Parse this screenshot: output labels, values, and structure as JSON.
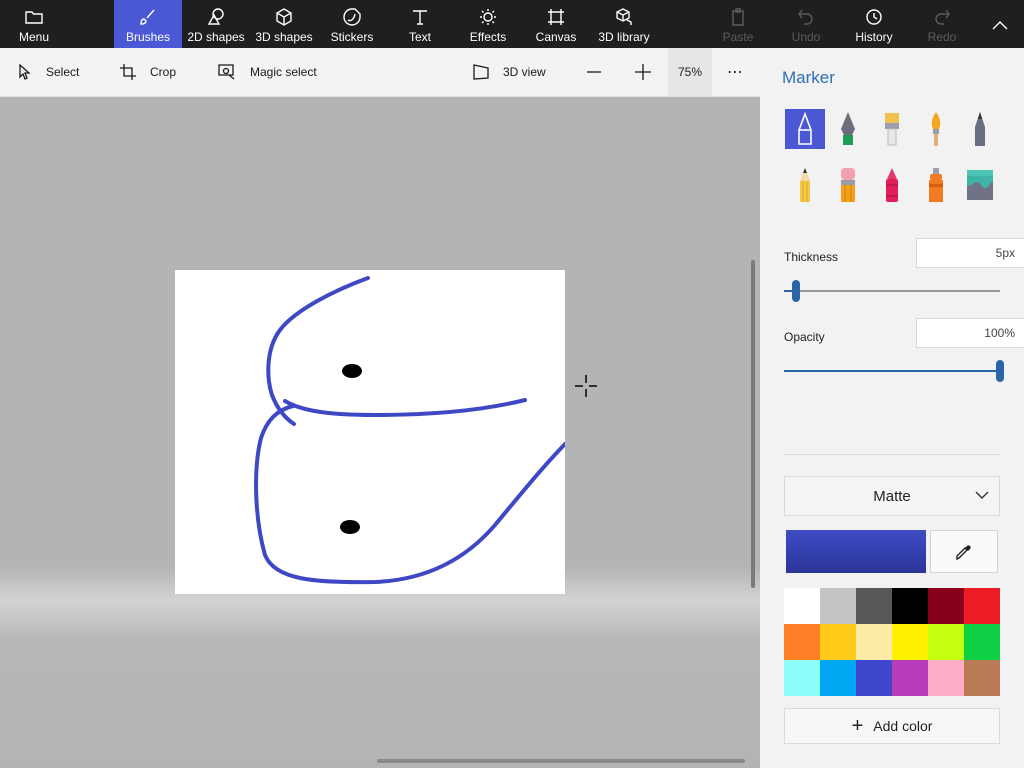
{
  "ribbon": {
    "menu": "Menu",
    "tabs": [
      "Brushes",
      "2D shapes",
      "3D shapes",
      "Stickers",
      "Text",
      "Effects",
      "Canvas",
      "3D library"
    ],
    "actions": {
      "paste": "Paste",
      "undo": "Undo",
      "history": "History",
      "redo": "Redo"
    }
  },
  "toolbar": {
    "select": "Select",
    "crop": "Crop",
    "magic_select": "Magic select",
    "view3d": "3D view",
    "zoom": "75%",
    "more": "⋯"
  },
  "panel": {
    "title": "Marker",
    "brushes": [
      "marker",
      "calligraphy-pen",
      "oil-brush",
      "watercolor",
      "pixel-pen",
      "pencil",
      "eraser",
      "crayon",
      "spray-can",
      "fill"
    ],
    "thickness_label": "Thickness",
    "thickness_value": "5px",
    "thickness_level": 0.05,
    "opacity_label": "Opacity",
    "opacity_value": "100%",
    "opacity_level": 1.0,
    "finish": "Matte",
    "current_color": "#3f4cc6",
    "palette": [
      "#ffffff",
      "#c3c3c3",
      "#585858",
      "#000000",
      "#88001b",
      "#ec1c24",
      "#ff7f27",
      "#ffca18",
      "#fdeca6",
      "#fff200",
      "#c4ff0e",
      "#0ed145",
      "#8cfffb",
      "#00a8f3",
      "#3f48cc",
      "#b83dba",
      "#ffaec8",
      "#b97a56"
    ],
    "add_color": "Add color"
  }
}
